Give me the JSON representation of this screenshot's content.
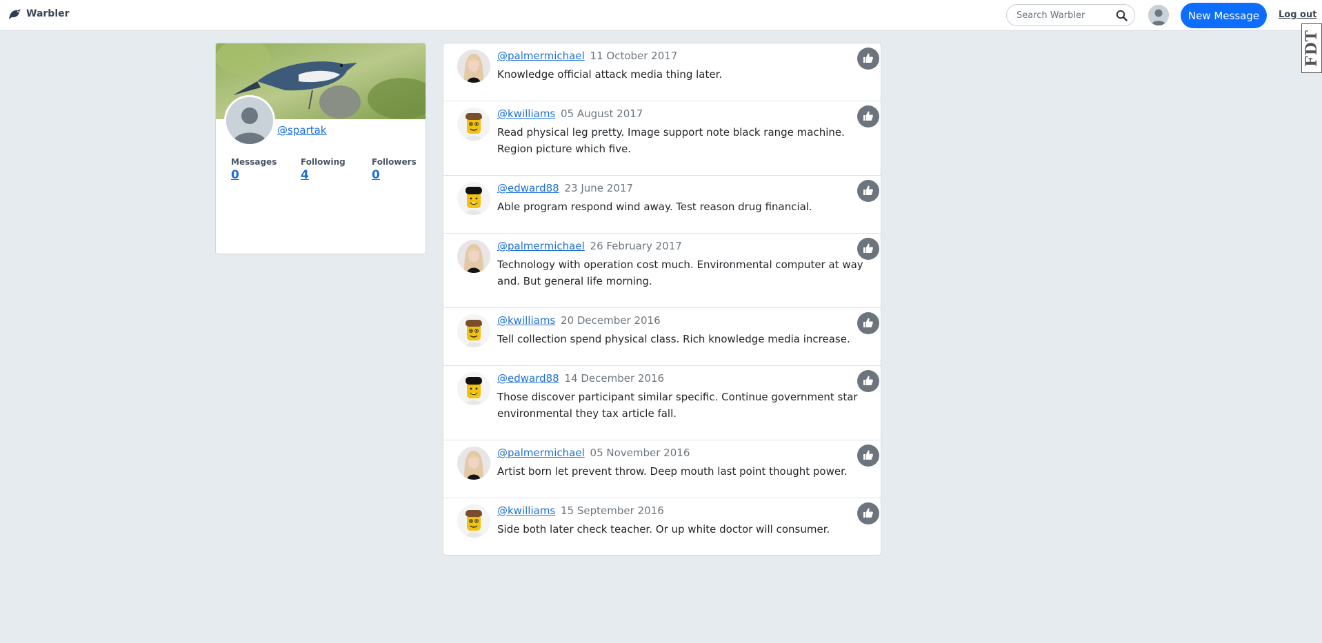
{
  "navbar": {
    "brand": "Warbler",
    "search_placeholder": "Search Warbler",
    "new_message_label": "New Message",
    "logout_label": "Log out",
    "edge_tab_label": "FDT"
  },
  "profile": {
    "username": "@spartak",
    "stats": [
      {
        "label": "Messages",
        "value": "0"
      },
      {
        "label": "Following",
        "value": "4"
      },
      {
        "label": "Followers",
        "value": "0"
      }
    ]
  },
  "messages": [
    {
      "user": "@palmermichael",
      "date": "11 October 2017",
      "text": "Knowledge official attack media thing later.",
      "avatar": "blonde-woman"
    },
    {
      "user": "@kwilliams",
      "date": "05 August 2017",
      "text": "Read physical leg pretty. Image support note black range machine. Region picture which five.",
      "avatar": "lego-brown"
    },
    {
      "user": "@edward88",
      "date": "23 June 2017",
      "text": "Able program respond wind away. Test reason drug financial.",
      "avatar": "lego-black"
    },
    {
      "user": "@palmermichael",
      "date": "26 February 2017",
      "text": "Technology with operation cost much. Environmental computer at way and. But general life morning.",
      "avatar": "blonde-woman"
    },
    {
      "user": "@kwilliams",
      "date": "20 December 2016",
      "text": "Tell collection spend physical class. Rich knowledge media increase.",
      "avatar": "lego-brown"
    },
    {
      "user": "@edward88",
      "date": "14 December 2016",
      "text": "Those discover participant similar specific. Continue government star environmental they tax article fall.",
      "avatar": "lego-black"
    },
    {
      "user": "@palmermichael",
      "date": "05 November 2016",
      "text": "Artist born let prevent throw. Deep mouth last point thought power.",
      "avatar": "blonde-woman"
    },
    {
      "user": "@kwilliams",
      "date": "15 September 2016",
      "text": "Side both later check teacher. Or up white doctor will consumer.",
      "avatar": "lego-brown"
    }
  ],
  "colors": {
    "accent": "#0d6efd",
    "link": "#1a6fd8",
    "background": "#e6ebef",
    "like_button": "#6c757d"
  }
}
